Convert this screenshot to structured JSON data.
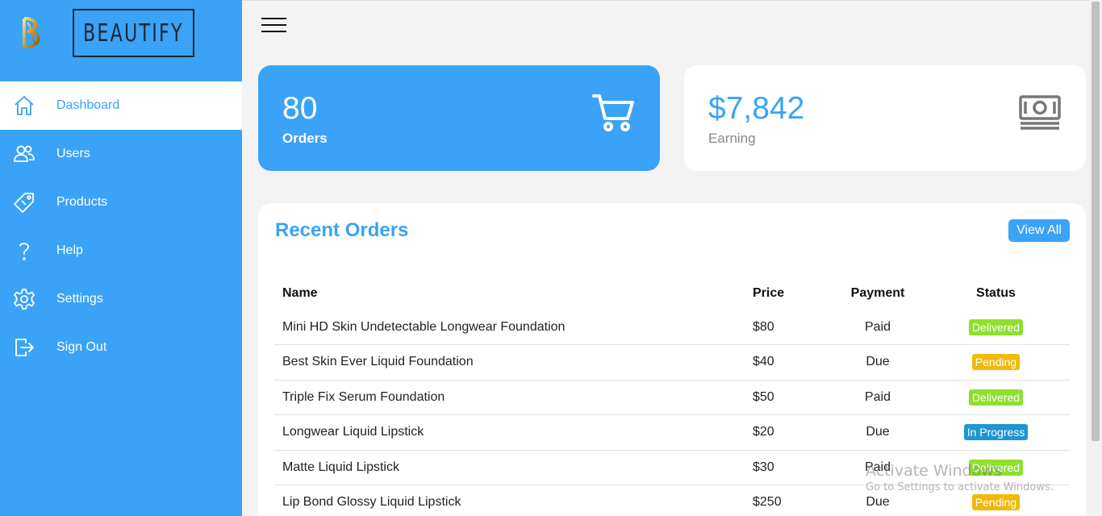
{
  "brand": {
    "name": "BEAUTIFY",
    "logo_icon": "b-monogram-logo"
  },
  "sidebar": {
    "items": [
      {
        "label": "Dashboard",
        "icon": "home-icon",
        "active": true
      },
      {
        "label": "Users",
        "icon": "users-icon"
      },
      {
        "label": "Products",
        "icon": "tag-icon"
      },
      {
        "label": "Help",
        "icon": "question-icon"
      },
      {
        "label": "Settings",
        "icon": "gear-icon"
      },
      {
        "label": "Sign Out",
        "icon": "sign-out-icon"
      }
    ]
  },
  "header": {
    "menu_icon": "hamburger-icon"
  },
  "cards": {
    "orders": {
      "value": "80",
      "label": "Orders",
      "icon": "cart-icon"
    },
    "earning": {
      "value": "$7,842",
      "label": "Earning",
      "icon": "money-icon"
    }
  },
  "recent_orders": {
    "title": "Recent Orders",
    "view_all_label": "View All",
    "columns": [
      "Name",
      "Price",
      "Payment",
      "Status"
    ],
    "rows": [
      {
        "name": "Mini HD Skin Undetectable Longwear Foundation",
        "price": "$80",
        "payment": "Paid",
        "status": "Delivered"
      },
      {
        "name": "Best Skin Ever Liquid Foundation",
        "price": "$40",
        "payment": "Due",
        "status": "Pending"
      },
      {
        "name": "Triple Fix Serum Foundation",
        "price": "$50",
        "payment": "Paid",
        "status": "Delivered"
      },
      {
        "name": "Longwear Liquid Lipstick",
        "price": "$20",
        "payment": "Due",
        "status": "In Progress"
      },
      {
        "name": "Matte Liquid Lipstick",
        "price": "$30",
        "payment": "Paid",
        "status": "Delivered"
      },
      {
        "name": "Lip Bond Glossy Liquid Lipstick",
        "price": "$250",
        "payment": "Due",
        "status": "Pending"
      }
    ]
  },
  "status_colors": {
    "Delivered": "#8de02c",
    "Pending": "#f0b90b",
    "In Progress": "#1e96d2"
  },
  "colors": {
    "accent": "#3aa3f7",
    "sidebar_bg": "#3aa3f7"
  },
  "watermark": {
    "line1": "Activate Windows",
    "line2": "Go to Settings to activate Windows."
  }
}
